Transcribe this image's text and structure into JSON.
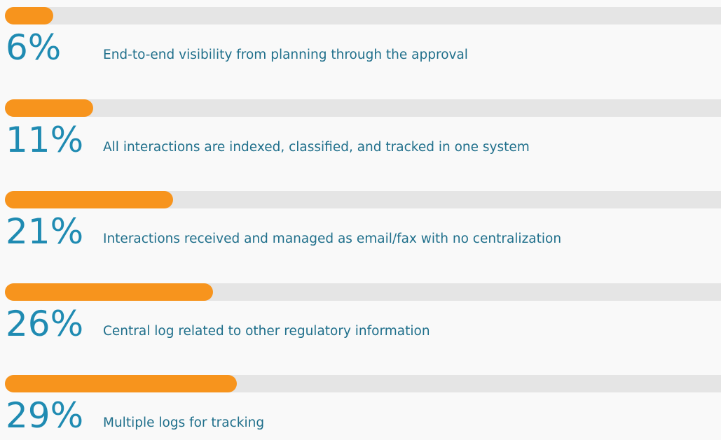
{
  "chart_data": {
    "type": "bar",
    "orientation": "horizontal",
    "title": "",
    "xlabel": "",
    "ylabel": "",
    "xlim": [
      0,
      100
    ],
    "grid": false,
    "legend": "none",
    "colors": {
      "fill": "#f7941d",
      "track": "#e5e5e5",
      "percent_text": "#1f8bb2",
      "label_text": "#1f6f8b",
      "background": "#f9f9f9"
    },
    "items": [
      {
        "value": 6,
        "value_label": "6%",
        "label": "End-to-end visibility from planning through the approval"
      },
      {
        "value": 11,
        "value_label": "11%",
        "label": "All interactions are indexed, classified, and tracked in one system"
      },
      {
        "value": 21,
        "value_label": "21%",
        "label": "Interactions received and managed as email/fax with no centralization"
      },
      {
        "value": 26,
        "value_label": "26%",
        "label": "Central log related to other regulatory information"
      },
      {
        "value": 29,
        "value_label": "29%",
        "label": "Multiple logs for tracking"
      }
    ]
  }
}
